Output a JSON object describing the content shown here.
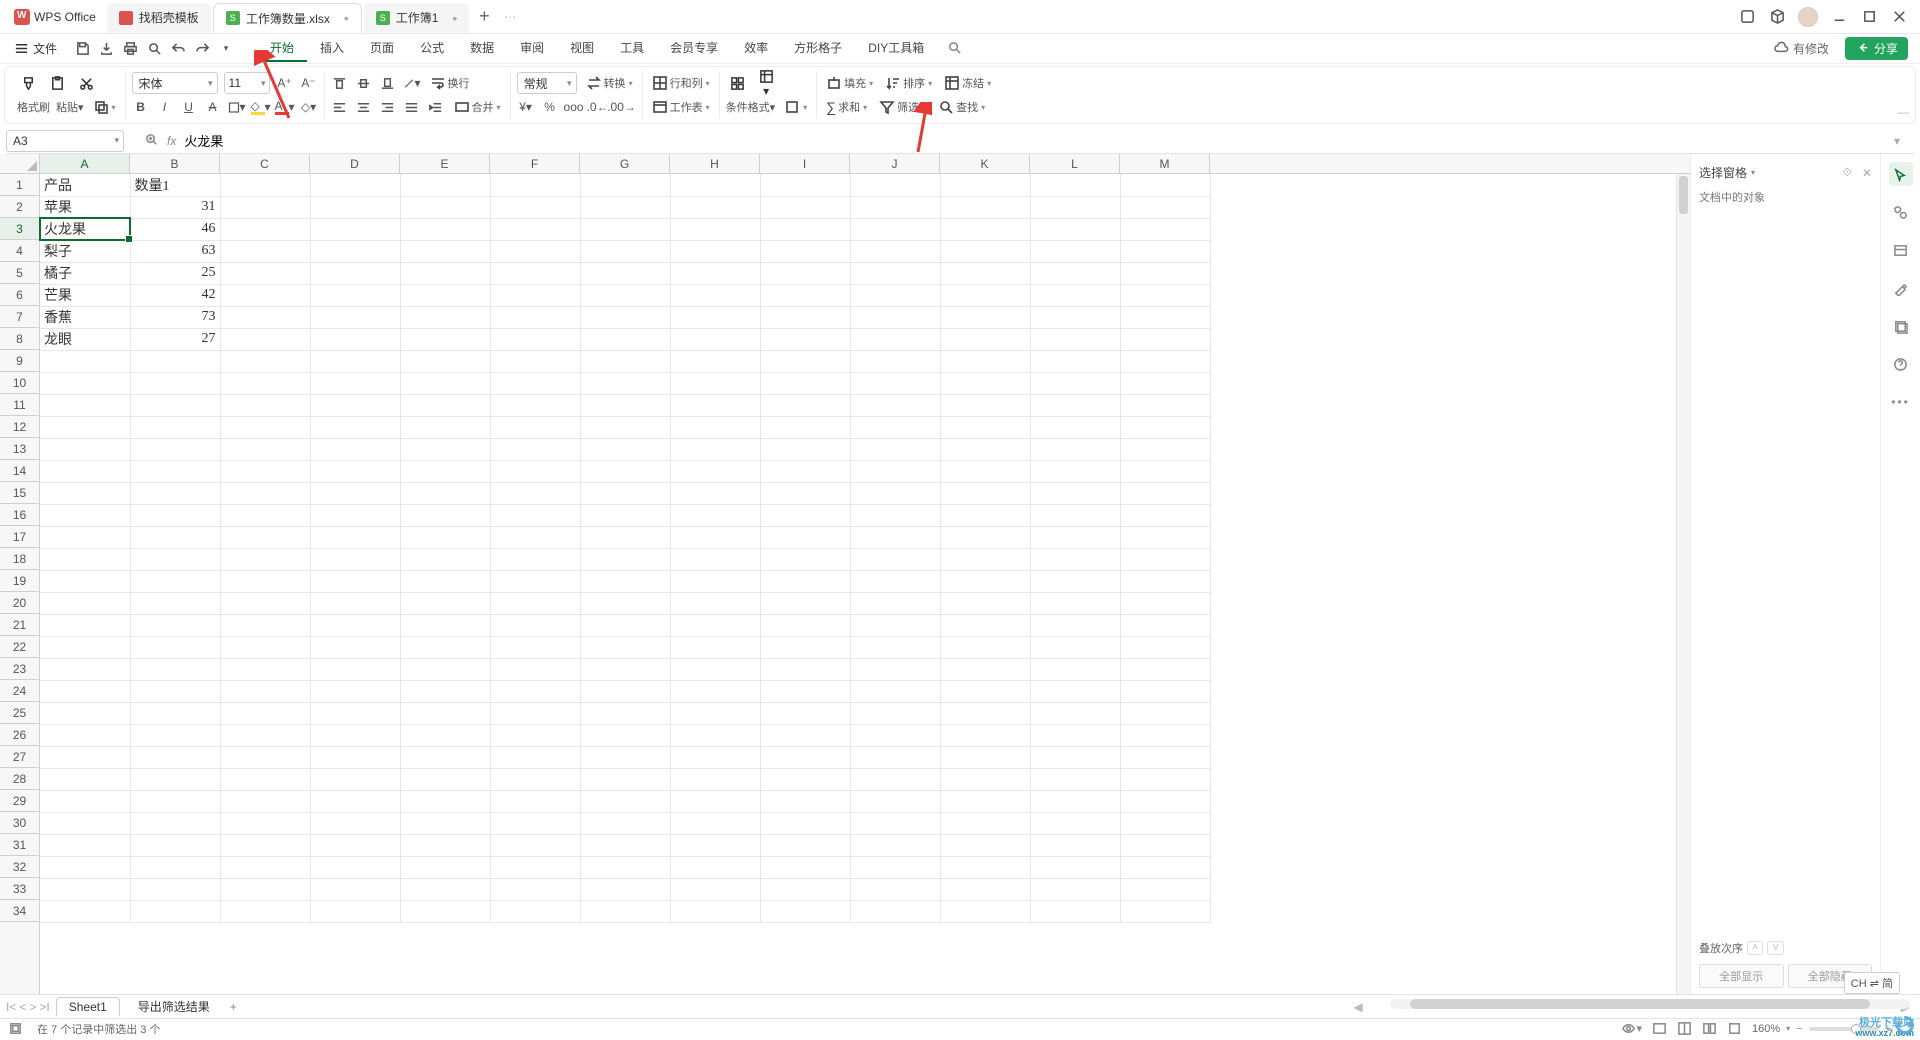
{
  "app": {
    "name": "WPS Office"
  },
  "tabs": [
    {
      "label": "找稻壳模板",
      "icon": "red",
      "active": false
    },
    {
      "label": "工作簿数量.xlsx",
      "icon": "green",
      "glyph": "S",
      "active": true,
      "dirty": true
    },
    {
      "label": "工作簿1",
      "icon": "green",
      "glyph": "S",
      "active": false,
      "dirty": true
    }
  ],
  "title_right": {
    "has_changes": "有修改",
    "share": "分享"
  },
  "menubar": {
    "file": "文件",
    "items": [
      "开始",
      "插入",
      "页面",
      "公式",
      "数据",
      "审阅",
      "视图",
      "工具",
      "会员专享",
      "效率",
      "方形格子",
      "DIY工具箱"
    ],
    "active_index": 0
  },
  "ribbon": {
    "clipboard": {
      "format_painter": "格式刷",
      "paste": "粘贴"
    },
    "font": {
      "family": "宋体",
      "size": "11"
    },
    "number_fmt": {
      "general": "常规",
      "convert": "转换"
    },
    "cells": {
      "rowcol": "行和列",
      "worksheet": "工作表"
    },
    "cond": {
      "cond_format": "条件格式"
    },
    "group_tools": {
      "fill": "填充",
      "sort": "排序",
      "freeze": "冻结",
      "sum": "求和",
      "filter": "筛选",
      "find": "查找"
    },
    "wrap": "换行",
    "merge": "合并"
  },
  "formula_bar": {
    "cell_ref": "A3",
    "value": "火龙果"
  },
  "columns": [
    "A",
    "B",
    "C",
    "D",
    "E",
    "F",
    "G",
    "H",
    "I",
    "J",
    "K",
    "L",
    "M"
  ],
  "row_count": 34,
  "selected": {
    "row": 3,
    "col": 0
  },
  "sheet_data": {
    "header": [
      "产品",
      "数量1"
    ],
    "rows": [
      [
        "苹果",
        31
      ],
      [
        "火龙果",
        46
      ],
      [
        "梨子",
        63
      ],
      [
        "橘子",
        25
      ],
      [
        "芒果",
        42
      ],
      [
        "香蕉",
        73
      ],
      [
        "龙眼",
        27
      ]
    ]
  },
  "side_panel": {
    "title": "选择窗格",
    "subtitle": "文档中的对象",
    "layer_label": "叠放次序",
    "show_all": "全部显示",
    "hide_all": "全部隐藏"
  },
  "sheet_tabs": {
    "tabs": [
      "Sheet1",
      "导出筛选结果"
    ],
    "active_index": 0
  },
  "status_bar": {
    "filter_info": "在 7 个记录中筛选出 3 个",
    "zoom": "160%"
  },
  "ime": "CH ⇌ 简",
  "watermark": {
    "line1": "极光下载站",
    "line2": "www.xz7.com"
  }
}
